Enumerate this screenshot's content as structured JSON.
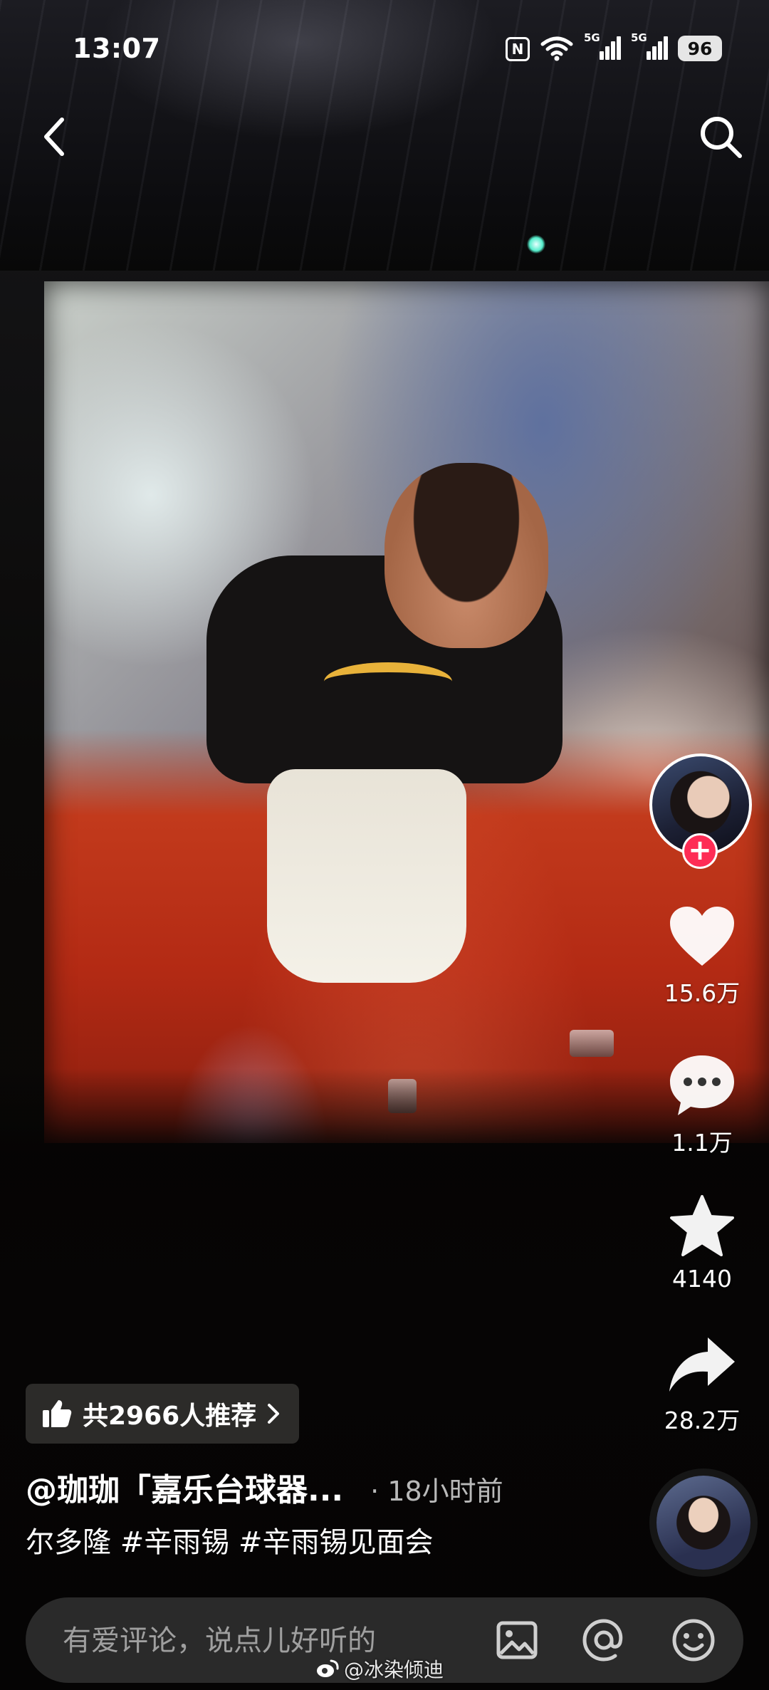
{
  "status_bar": {
    "time": "13:07",
    "signal_1_label": "5G",
    "signal_2_label": "5G",
    "battery": "96",
    "nfc_label": "N"
  },
  "nav": {
    "back_icon": "chevron-left-icon",
    "search_icon": "search-icon"
  },
  "actions": {
    "likes": "15.6万",
    "comments": "1.1万",
    "favorites": "4140",
    "shares": "28.2万",
    "follow_symbol": "+"
  },
  "post": {
    "recommend": "共2966人推荐",
    "author": "@珈珈「嘉乐台球器...",
    "time": "· 18小时前",
    "caption": "尔多隆 #辛雨锡 #辛雨锡见面会"
  },
  "comment_bar": {
    "placeholder": "有爱评论，说点儿好听的"
  },
  "watermark": "@冰染倾迪",
  "colors": {
    "accent": "#fe2c55",
    "background": "#050404",
    "input_bg": "#2a2a2a"
  }
}
